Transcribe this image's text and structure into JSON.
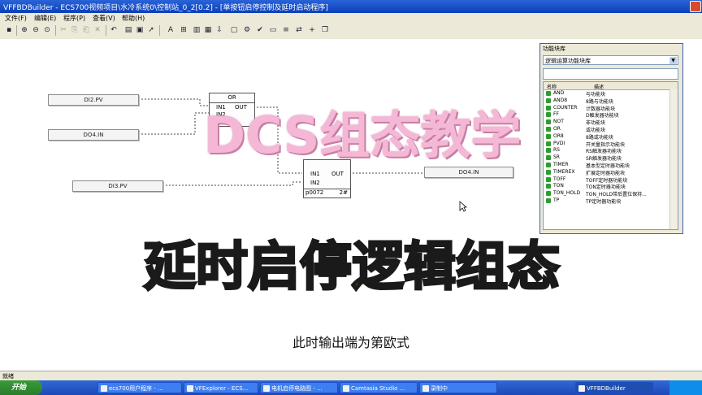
{
  "titlebar": {
    "text": "VFFBDBuilder - ECS700视频项目\\水冷系统0\\控制站_0_2[0.2] - [单按钮启停控制及延时启动程序]"
  },
  "menu": {
    "items": [
      "文件(F)",
      "编辑(E)",
      "程序(P)",
      "查看(V)",
      "帮助(H)"
    ]
  },
  "canvas": {
    "pv_blocks": [
      "DI2.PV",
      "DO4.IN",
      "DI3.PV",
      "DO4.IN"
    ],
    "or_block": {
      "name": "OR",
      "in1": "IN1",
      "in2": "IN2",
      "out": "OUT"
    },
    "and_block": {
      "in1": "IN1",
      "in2": "IN2",
      "out": "OUT",
      "id": "p0072",
      "num": "2#"
    }
  },
  "library": {
    "title": "功能块库",
    "category": "逻辑运算功能块库",
    "col_name": "名称",
    "col_desc": "描述",
    "items": [
      {
        "name": "AND",
        "desc": "与功能块"
      },
      {
        "name": "AND8",
        "desc": "8路与功能块"
      },
      {
        "name": "COUNTER",
        "desc": "计数器功能块"
      },
      {
        "name": "FF",
        "desc": "D触发器功能块"
      },
      {
        "name": "NOT",
        "desc": "非功能块"
      },
      {
        "name": "OR",
        "desc": "或功能块"
      },
      {
        "name": "OR8",
        "desc": "8路或功能块"
      },
      {
        "name": "PVDI",
        "desc": "开关量指示功能块"
      },
      {
        "name": "RS",
        "desc": "RS触发器功能块"
      },
      {
        "name": "SR",
        "desc": "SR触发器功能块"
      },
      {
        "name": "TIMER",
        "desc": "基本型定时器功能块"
      },
      {
        "name": "TIMEREX",
        "desc": "扩展定时器功能块"
      },
      {
        "name": "TOFF",
        "desc": "TOFF定时器功能块"
      },
      {
        "name": "TON",
        "desc": "TON定时器功能块"
      },
      {
        "name": "TON_HOLD",
        "desc": "TON_HOLD带后置位保持..."
      },
      {
        "name": "TP",
        "desc": "TP定时器功能块"
      }
    ]
  },
  "overlay": {
    "title": "DCS组态教学",
    "headline": "延时启停逻辑组态",
    "subtitle": "此时输出端为第欧式"
  },
  "status": {
    "text": "就绪"
  },
  "taskbar": {
    "start": "开始",
    "tasks": [
      "ecs700用户程序 - ...",
      "VFExplorer - ECS...",
      "电机启停电路图 - ...",
      "Camtasia Studio ...",
      "录制中",
      "VFFBDBuilder"
    ]
  },
  "colors": {
    "title_pink": "#f4b8d6",
    "headline_yellow": "#fff200",
    "taskbar_blue": "#245edb"
  }
}
